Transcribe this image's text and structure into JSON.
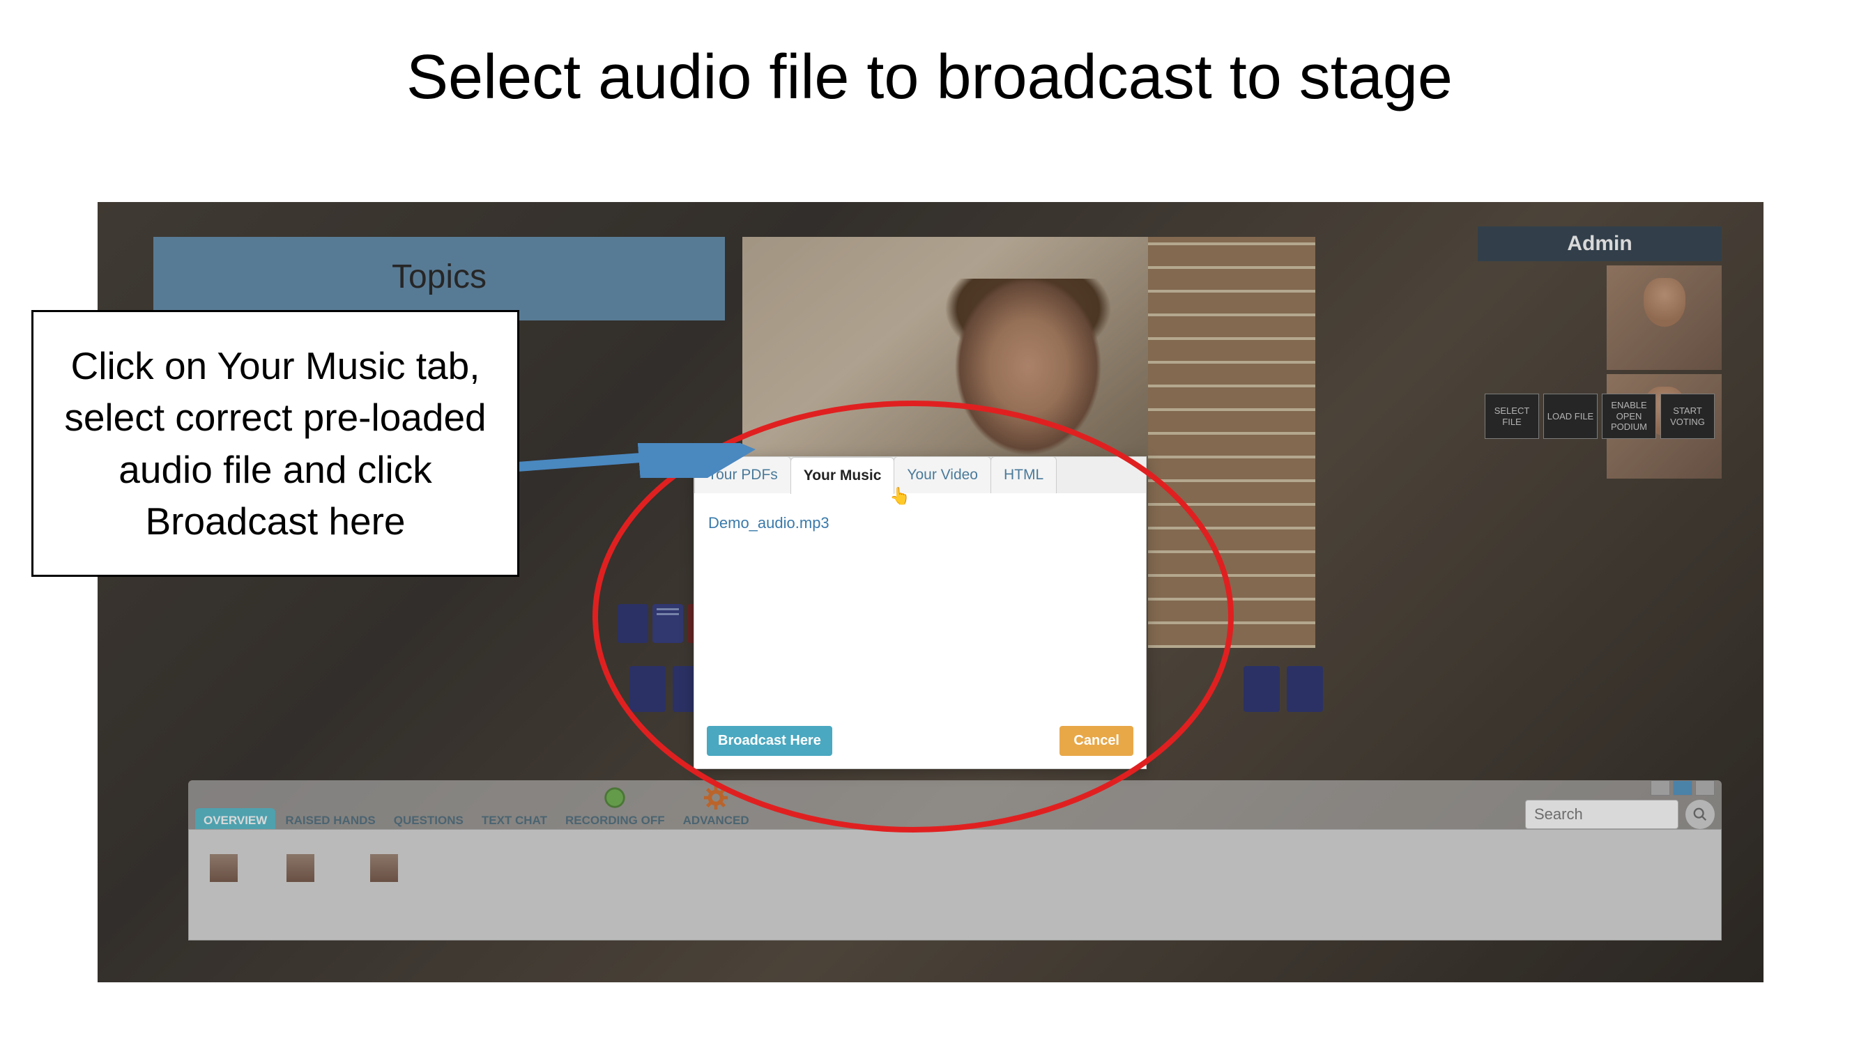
{
  "slide": {
    "title": "Select audio file to broadcast to stage",
    "callout_text": "Click on Your Music tab, select correct pre-loaded audio file and click Broadcast here"
  },
  "topics_panel": {
    "title": "Topics"
  },
  "admin": {
    "label": "Admin",
    "buttons": [
      "SELECT FILE",
      "LOAD FILE",
      "ENABLE OPEN PODIUM",
      "START VOTING"
    ]
  },
  "bottom_tabs": [
    "OVERVIEW",
    "RAISED HANDS",
    "QUESTIONS",
    "TEXT CHAT",
    "RECORDING OFF",
    "ADVANCED"
  ],
  "search": {
    "placeholder": "Search"
  },
  "dialog": {
    "tabs": [
      "Your PDFs",
      "Your Music",
      "Your Video",
      "HTML"
    ],
    "active_tab_index": 1,
    "file": "Demo_audio.mp3",
    "broadcast_label": "Broadcast Here",
    "cancel_label": "Cancel"
  }
}
